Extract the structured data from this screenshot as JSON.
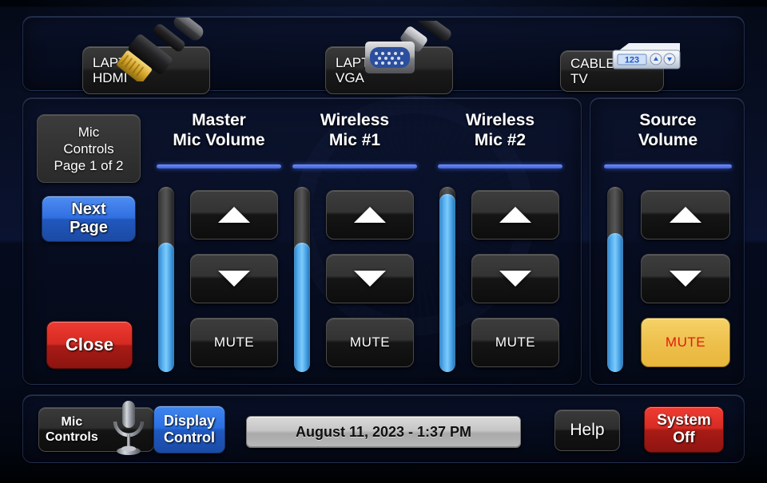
{
  "sources": {
    "buttons": [
      {
        "label": "LAPTOP\nHDMI",
        "icon": "hdmi-cable-icon"
      },
      {
        "label": "LAPTOP\nVGA",
        "icon": "vga-connector-icon"
      },
      {
        "label": "CABLE\nTV",
        "icon": "cable-set-top-box-icon"
      }
    ]
  },
  "mic_panel": {
    "page_button": {
      "label": "Mic\nControls\nPage 1 of 2"
    },
    "next_page_button": {
      "label": "Next\nPage"
    },
    "close_button": {
      "label": "Close"
    },
    "channels": [
      {
        "title": "Master\nMic Volume",
        "level": 70,
        "mute_label": "MUTE",
        "muted": false
      },
      {
        "title": "Wireless\nMic #1",
        "level": 70,
        "mute_label": "MUTE",
        "muted": false
      },
      {
        "title": "Wireless\nMic #2",
        "level": 96,
        "mute_label": "MUTE",
        "muted": false
      }
    ]
  },
  "source_panel": {
    "channel": {
      "title": "Source\nVolume",
      "level": 75,
      "mute_label": "MUTE",
      "muted": true
    }
  },
  "bottom_bar": {
    "mic_controls_label": "Mic\nControls",
    "display_control_label": "Display\nControl",
    "clock": "August 11, 2023  -  1:37 PM",
    "help_label": "Help",
    "system_off_label": "System\nOff"
  },
  "colors": {
    "accent_blue": "#3f5fe0",
    "slider_fill": "#56aeee",
    "mute_active_bg": "#eec14d",
    "mute_active_text": "#e01b10",
    "danger_red": "#d82b23"
  }
}
